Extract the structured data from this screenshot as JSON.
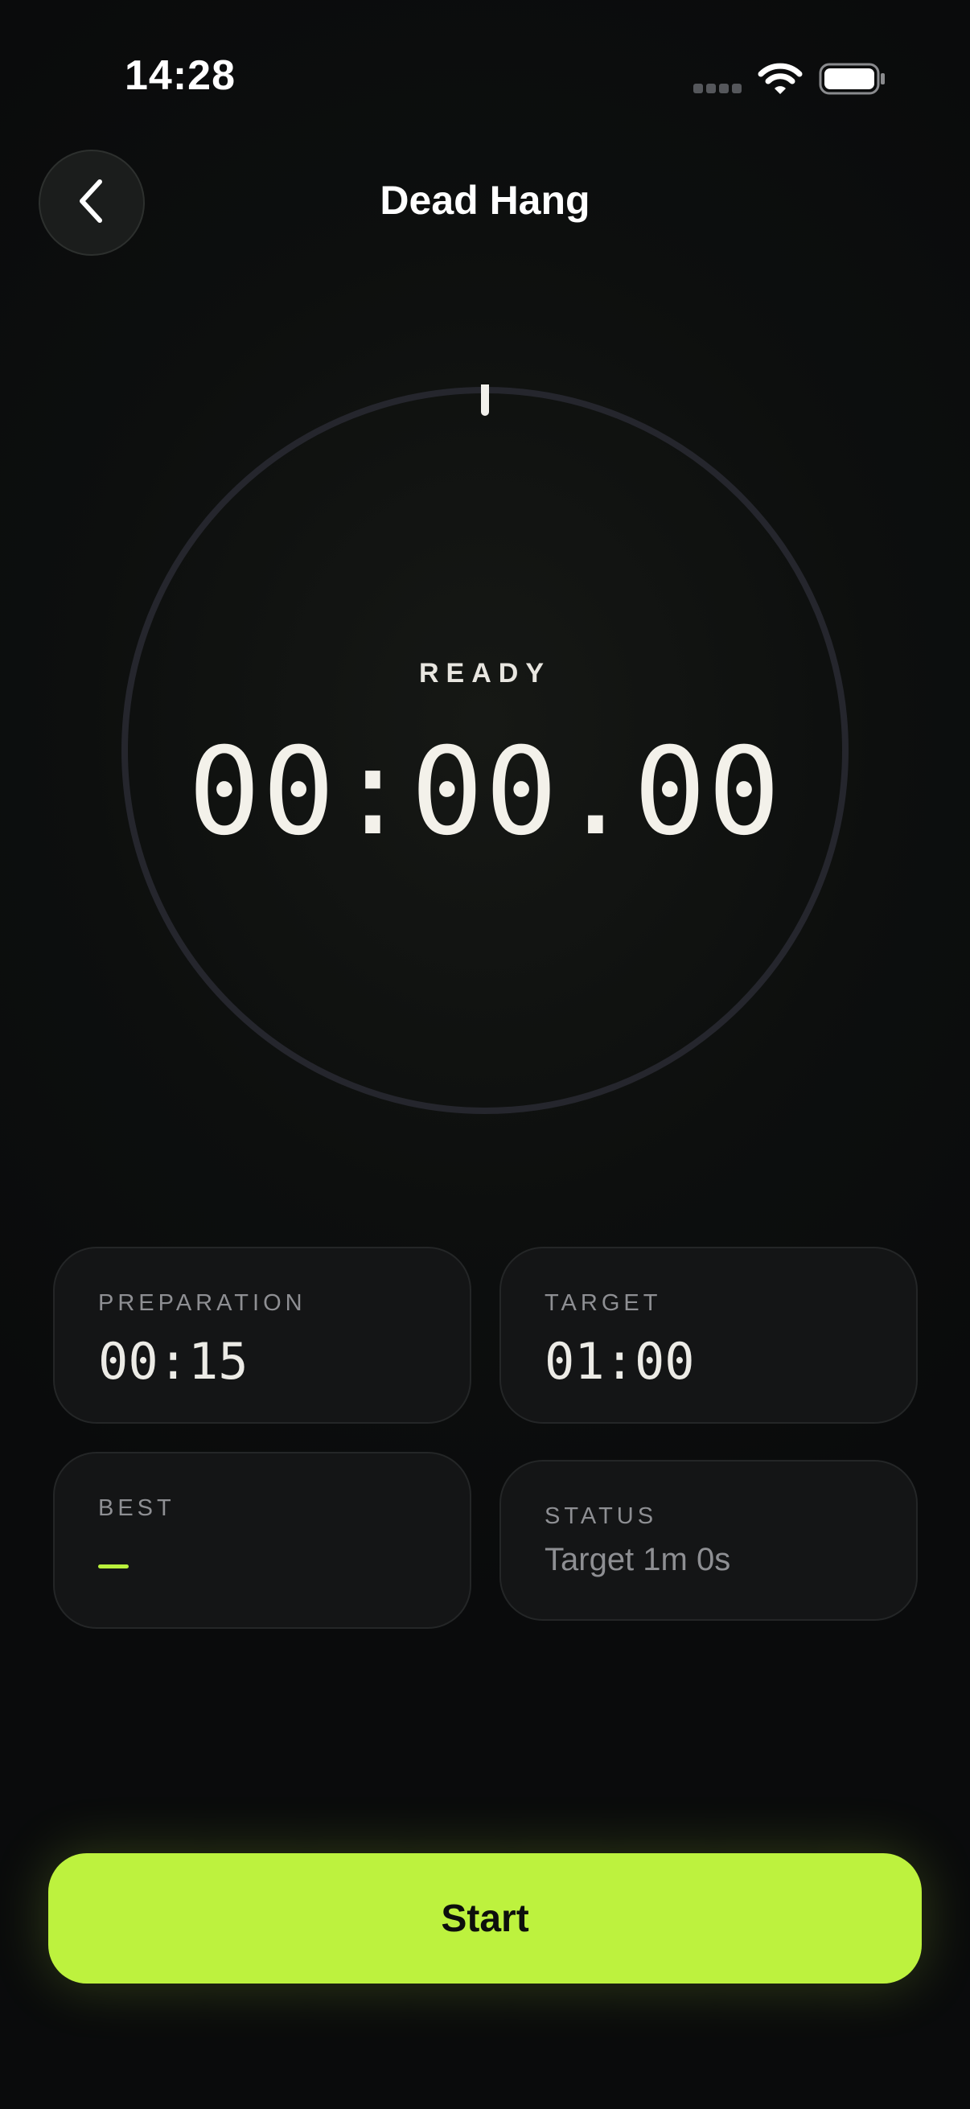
{
  "status_bar": {
    "time": "14:28",
    "icons": [
      "signal-icon",
      "wifi-icon",
      "battery-icon"
    ]
  },
  "header": {
    "back_icon": "chevron-left-icon",
    "title": "Dead Hang"
  },
  "timer": {
    "label": "READY",
    "time": "00:00.00",
    "progress": 0
  },
  "cards": {
    "preparation": {
      "label": "PREPARATION",
      "value": "00:15"
    },
    "target": {
      "label": "TARGET",
      "value": "01:00"
    },
    "best": {
      "label": "BEST",
      "value": "—"
    },
    "status": {
      "label": "STATUS",
      "value": "Target 1m 0s"
    }
  },
  "actions": {
    "start_label": "Start"
  },
  "colors": {
    "accent": "#bdf23e",
    "background": "#0a0b0c",
    "ring": "#25262d",
    "card": "#141516"
  }
}
